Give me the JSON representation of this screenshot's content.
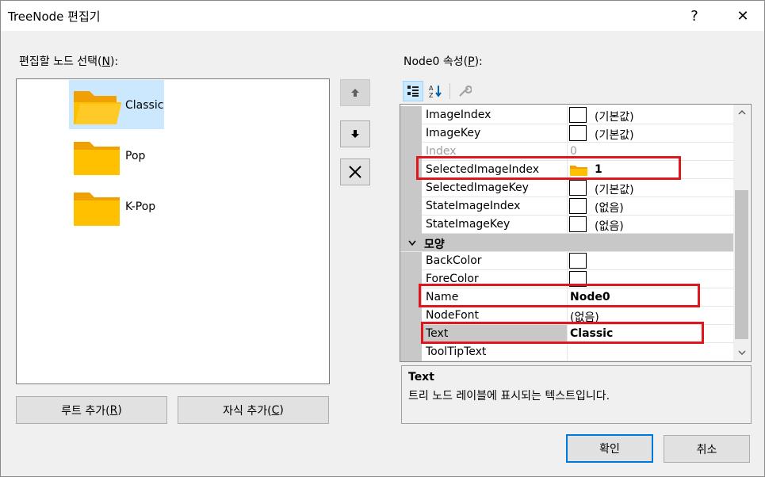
{
  "window": {
    "title": "TreeNode 편집기",
    "help_glyph": "?",
    "close_glyph": "✕"
  },
  "tree": {
    "label_prefix": "편집할 노드 선택(",
    "label_key": "N",
    "label_suffix": "):",
    "nodes": [
      {
        "label": "Classic",
        "selected": true
      },
      {
        "label": "Pop",
        "selected": false
      },
      {
        "label": "K-Pop",
        "selected": false
      }
    ]
  },
  "buttons": {
    "add_root_prefix": "루트 추가(",
    "add_root_key": "R",
    "add_root_suffix": ")",
    "add_child_prefix": "자식 추가(",
    "add_child_key": "C",
    "add_child_suffix": ")",
    "ok": "확인",
    "cancel": "취소"
  },
  "side_buttons": {
    "up_icon": "arrow-up-icon",
    "down_icon": "arrow-down-icon",
    "delete_icon": "delete-x-icon"
  },
  "properties": {
    "label_prefix": "Node0 속성(",
    "label_key": "P",
    "label_suffix": "):",
    "toolbar": [
      "categorized-icon",
      "alphabetical-sort-icon",
      "property-pages-icon"
    ],
    "rows": [
      {
        "name": "ImageIndex",
        "value": "(기본값)",
        "swatch": true
      },
      {
        "name": "ImageKey",
        "value": "(기본값)",
        "swatch": true
      },
      {
        "name": "Index",
        "value": "0",
        "dim": true
      },
      {
        "name": "SelectedImageIndex",
        "value": "1",
        "folder": true,
        "bold": true
      },
      {
        "name": "SelectedImageKey",
        "value": "(기본값)",
        "swatch": true
      },
      {
        "name": "StateImageIndex",
        "value": "(없음)",
        "swatch": true
      },
      {
        "name": "StateImageKey",
        "value": "(없음)",
        "swatch": true
      },
      {
        "name": "모양",
        "category": true
      },
      {
        "name": "BackColor",
        "value": "",
        "swatch": true
      },
      {
        "name": "ForeColor",
        "value": "",
        "swatch": true
      },
      {
        "name": "Name",
        "value": "Node0",
        "bold": true
      },
      {
        "name": "NodeFont",
        "value": "(없음)"
      },
      {
        "name": "Text",
        "value": "Classic",
        "bold": true,
        "selected": true
      },
      {
        "name": "ToolTipText",
        "value": ""
      }
    ],
    "description_title": "Text",
    "description_text": "트리 노드 레이블에 표시되는 텍스트입니다."
  },
  "colors": {
    "accent": "#0078d7",
    "highlight_red": "#e0161f",
    "folder": "#ffc000",
    "selection": "#cce8ff"
  }
}
